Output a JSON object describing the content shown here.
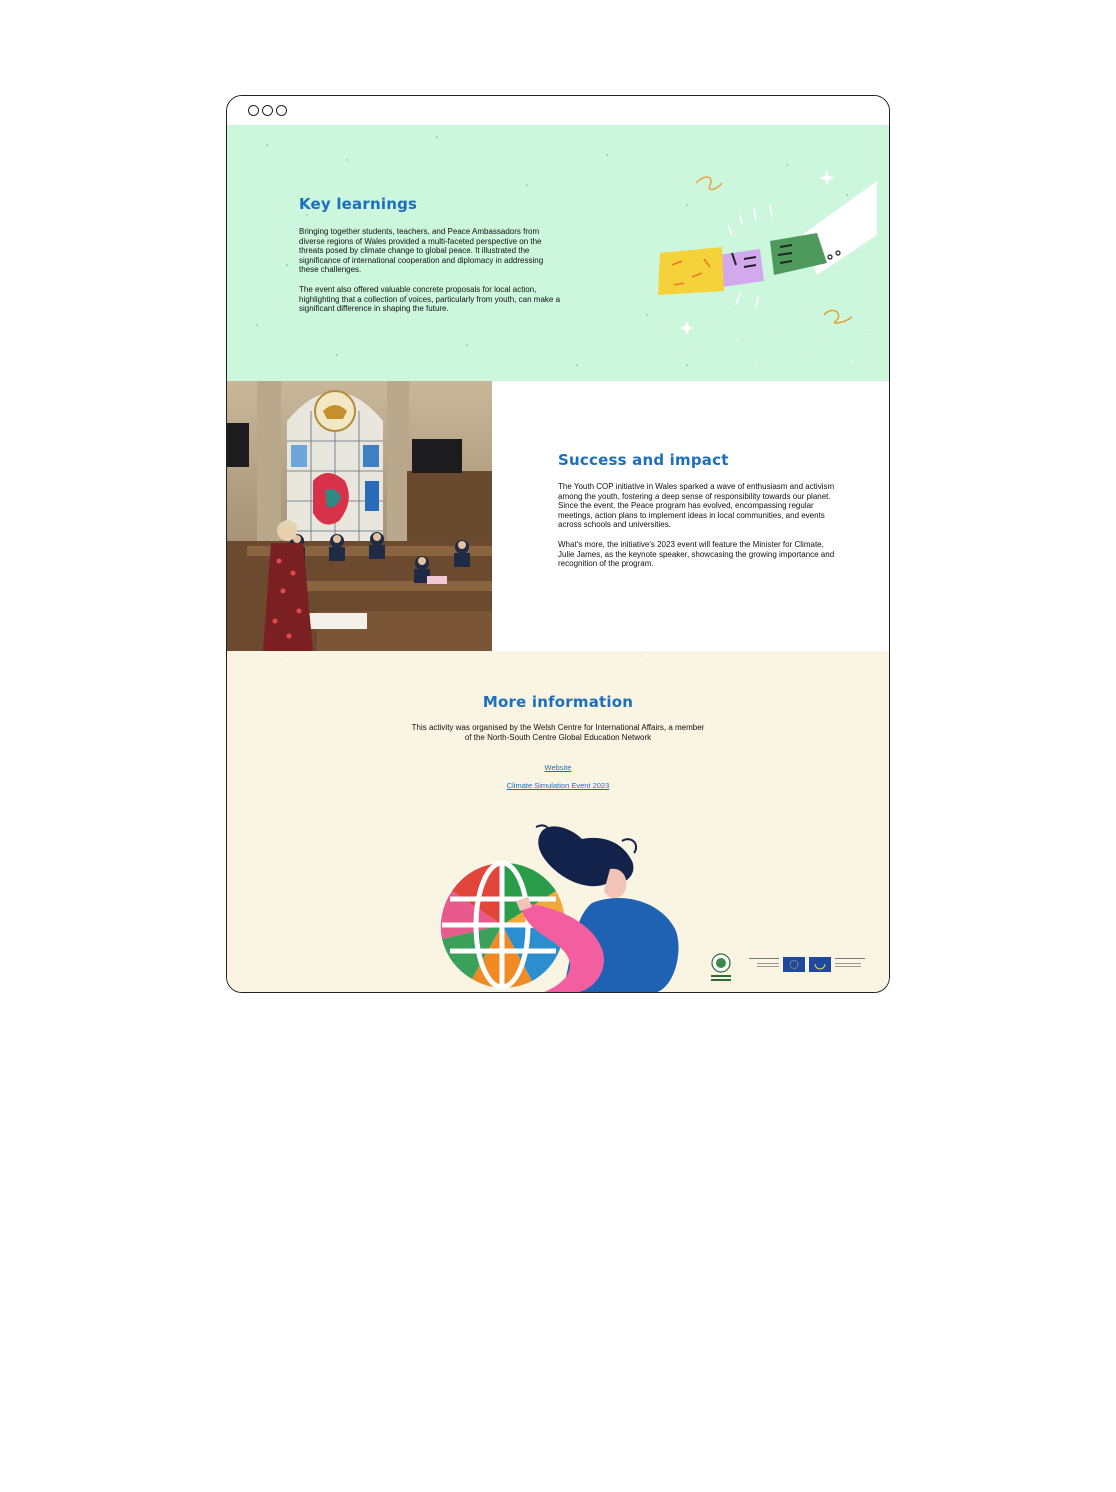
{
  "key_learnings": {
    "title": "Key learnings",
    "paragraph_1": "Bringing together students, teachers, and Peace Ambassadors from diverse regions of Wales provided a multi-faceted perspective on the threats posed by climate change to global peace. It illustrated the significance of international cooperation and diplomacy in addressing these challenges.",
    "paragraph_2": "The event also offered valuable concrete proposals for local action, highlighting that a collection of voices, particularly from youth, can make a significant difference in shaping the future."
  },
  "success": {
    "title": "Success and impact",
    "paragraph_1": "The Youth COP initiative in Wales sparked a wave of enthusiasm and activism among the youth, fostering a deep sense of responsibility towards our planet. Since the event, the Peace program has evolved, encompassing regular meetings, action plans to implement ideas in local communities, and events across schools and universities.",
    "paragraph_2": "What's more, the initiative's 2023 event will feature the Minister for Climate, Julie James, as the keynote speaker, showcasing the growing importance and recognition of the program."
  },
  "more_info": {
    "title": "More information",
    "description": "This activity was organised by the Welsh Centre for International Affairs, a member of the North-South Centre Global Education Network",
    "links": [
      "Website",
      "Climate Simulation Event 2023"
    ]
  },
  "colors": {
    "key_bg": "#ccf7dd",
    "more_bg": "#faf5e2",
    "heading": "#1b6fbd",
    "link": "#1b6fbd"
  },
  "icons": [
    "hands-fist-bump-illustration",
    "classroom-photo",
    "globe-woman-illustration",
    "partner-logos"
  ]
}
